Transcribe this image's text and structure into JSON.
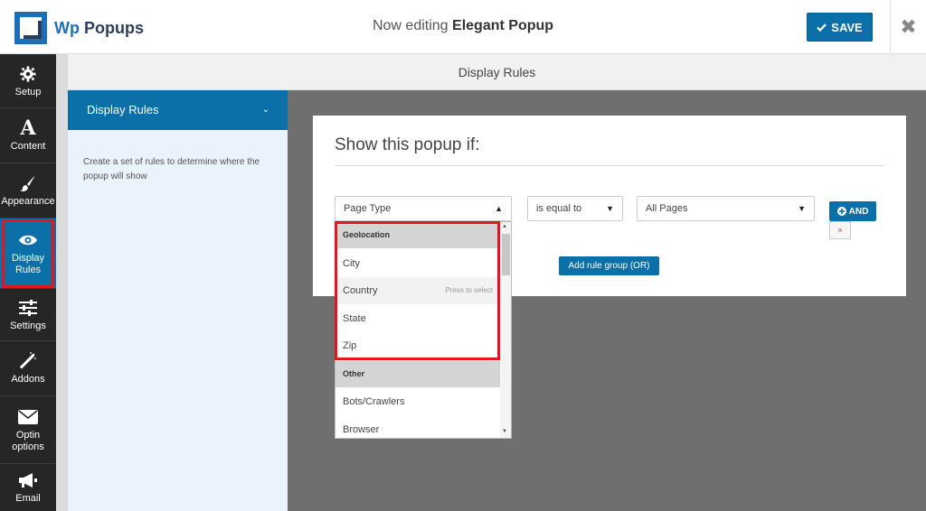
{
  "header": {
    "logo_wp": "Wp",
    "logo_rest": "Popups",
    "editing_prefix": "Now editing",
    "popup_name": "Elegant Popup",
    "save_label": "SAVE",
    "close_icon": "close-icon"
  },
  "iconbar": {
    "items": [
      {
        "label": "Setup",
        "icon": "gear-icon"
      },
      {
        "label": "Content",
        "icon": "font-icon"
      },
      {
        "label": "Appearance",
        "icon": "brush-icon"
      },
      {
        "label": "Display Rules",
        "icon": "eye-icon"
      },
      {
        "label": "Settings",
        "icon": "sliders-icon"
      },
      {
        "label": "Addons",
        "icon": "magic-wand-icon"
      },
      {
        "label": "Optin options",
        "icon": "envelope-icon"
      },
      {
        "label": "Email",
        "icon": "megaphone-icon"
      }
    ],
    "active": "Display Rules"
  },
  "panel": {
    "title": "Display Rules"
  },
  "subsidebar": {
    "section_title": "Display Rules",
    "description": "Create a set of rules to determine where the popup will show"
  },
  "rules": {
    "heading": "Show this popup if:",
    "field_select": "Page Type",
    "operator_select": "is equal to",
    "value_select": "All Pages",
    "and_label": "AND",
    "delete_label": "×",
    "add_group_label": "Add rule group (OR)"
  },
  "dropdown": {
    "groups": [
      {
        "label": "Geolocation",
        "options": [
          "City",
          "Country",
          "State",
          "Zip"
        ]
      },
      {
        "label": "Other",
        "options": [
          "Bots/Crawlers",
          "Browser"
        ]
      }
    ],
    "hovered_option": "Country",
    "hover_hint": "Press to select"
  },
  "colors": {
    "primary": "#0b6fa8",
    "sidebar_bg": "#262626",
    "highlight": "#e3161d",
    "canvas_bg": "#6f6f6f"
  }
}
